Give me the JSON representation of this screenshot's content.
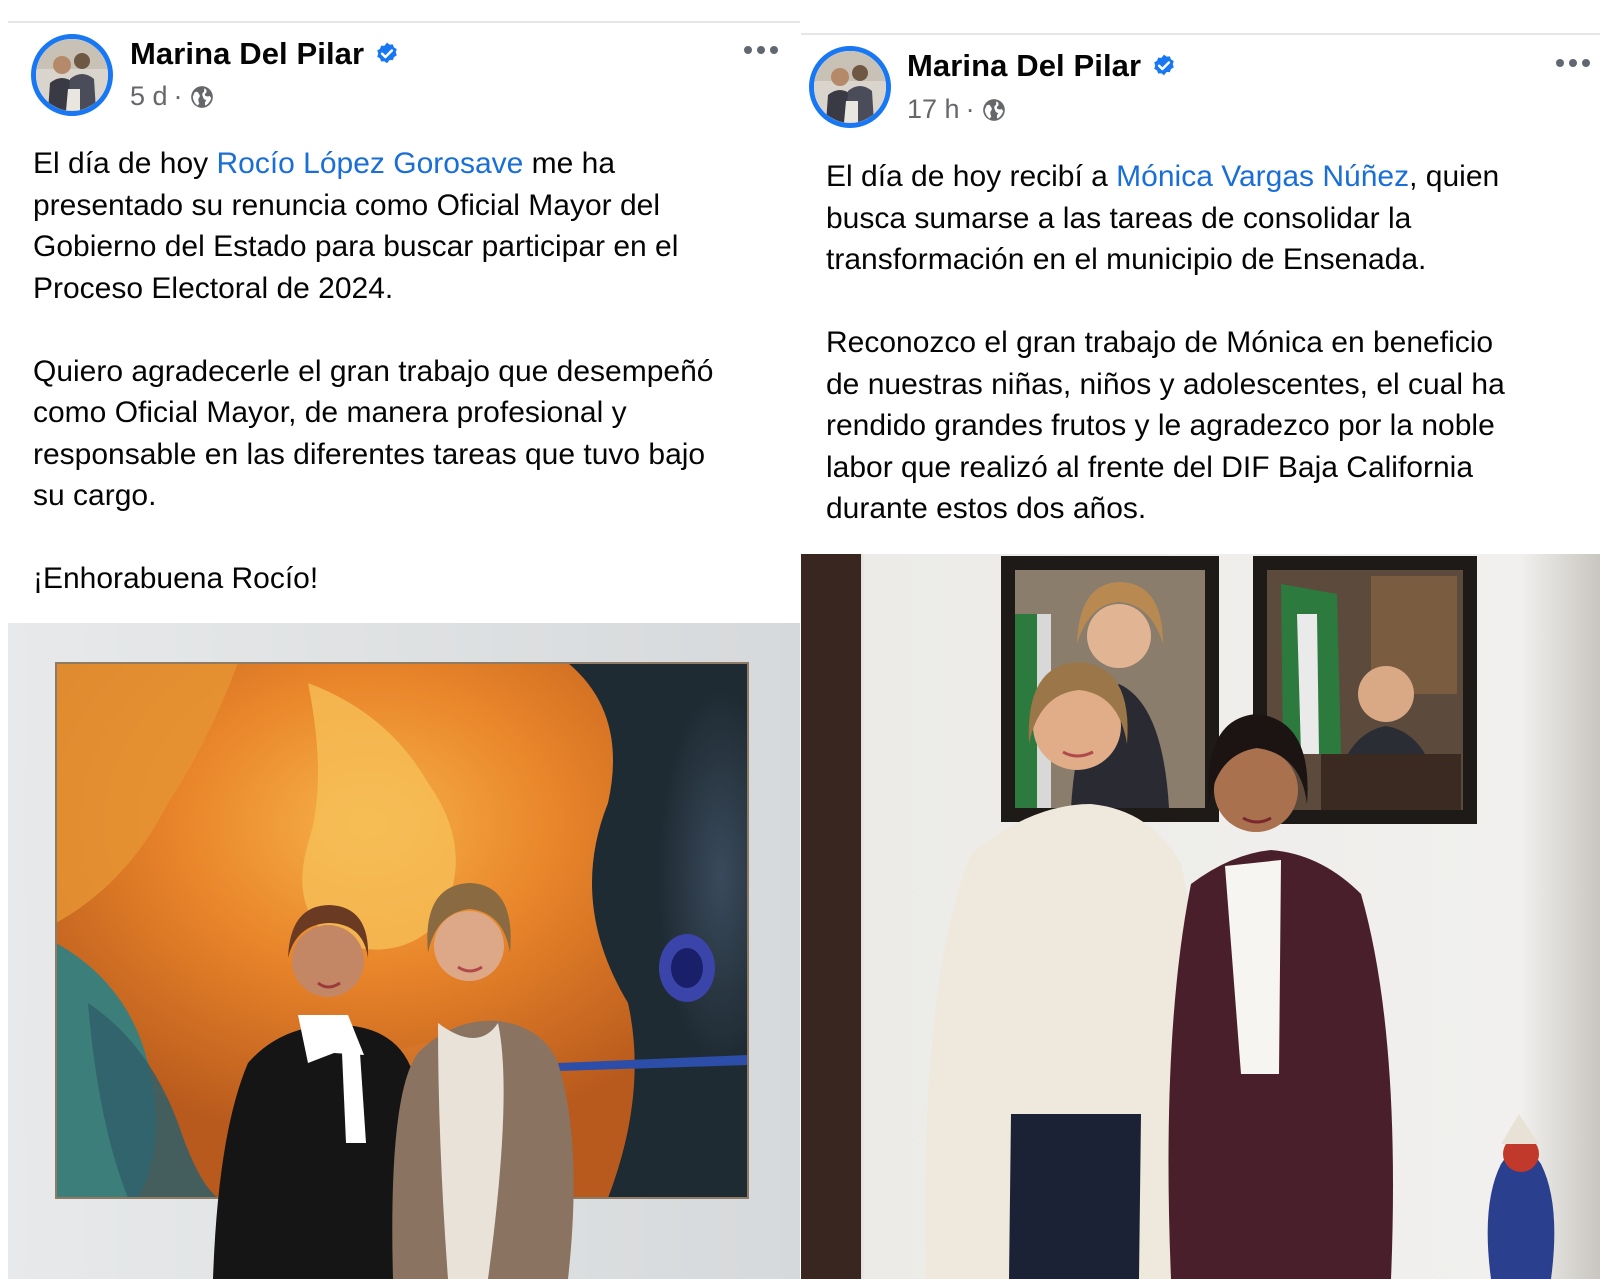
{
  "posts": [
    {
      "author": "Marina Del Pilar",
      "time": "5 d",
      "separator": "·",
      "paragraphs": [
        {
          "lines": [
            [
              {
                "t": "El día de hoy "
              },
              {
                "t": "Rocío López Gorosave",
                "mention": true
              },
              {
                "t": " me ha"
              }
            ],
            [
              {
                "t": "presentado su renuncia como Oficial Mayor del"
              }
            ],
            [
              {
                "t": "Gobierno del Estado para buscar participar en el"
              }
            ],
            [
              {
                "t": "Proceso Electoral de 2024."
              }
            ]
          ]
        },
        {
          "lines": [
            [
              {
                "t": "Quiero agradecerle el gran trabajo que desempeñó"
              }
            ],
            [
              {
                "t": "como Oficial Mayor, de manera profesional y"
              }
            ],
            [
              {
                "t": "responsable en las diferentes tareas que tuvo bajo"
              }
            ],
            [
              {
                "t": "su cargo."
              }
            ]
          ]
        },
        {
          "lines": [
            [
              {
                "t": "¡Enhorabuena Rocío!"
              }
            ]
          ]
        }
      ],
      "photo_description_icon": "photo-abstract-painting-two-women"
    },
    {
      "author": "Marina Del Pilar",
      "time": "17 h",
      "separator": "·",
      "paragraphs": [
        {
          "lines": [
            [
              {
                "t": "El día de hoy recibí a "
              },
              {
                "t": "Mónica Vargas Núñez",
                "mention": true
              },
              {
                "t": ", quien"
              }
            ],
            [
              {
                "t": "busca sumarse a las tareas de consolidar la"
              }
            ],
            [
              {
                "t": "transformación en el municipio de Ensenada."
              }
            ]
          ]
        },
        {
          "lines": [
            [
              {
                "t": "Reconozco el gran trabajo de Mónica en beneficio"
              }
            ],
            [
              {
                "t": "de nuestras niñas, niños y adolescentes, el cual ha"
              }
            ],
            [
              {
                "t": "rendido grandes frutos y le agradezco por la noble"
              }
            ],
            [
              {
                "t": "labor que realizó al frente del DIF Baja California"
              }
            ],
            [
              {
                "t": "durante estos dos años."
              }
            ]
          ]
        }
      ],
      "photo_description_icon": "photo-office-portraits-two-women"
    }
  ],
  "colors": {
    "verified_badge": "#1877f2",
    "mention_link": "#1a6ed8",
    "meta_text": "#65676b",
    "avatar_ring": "#1877f2"
  },
  "icons": {
    "verified": "verified-badge-icon",
    "audience": "globe-icon",
    "more": "more-options-icon"
  }
}
